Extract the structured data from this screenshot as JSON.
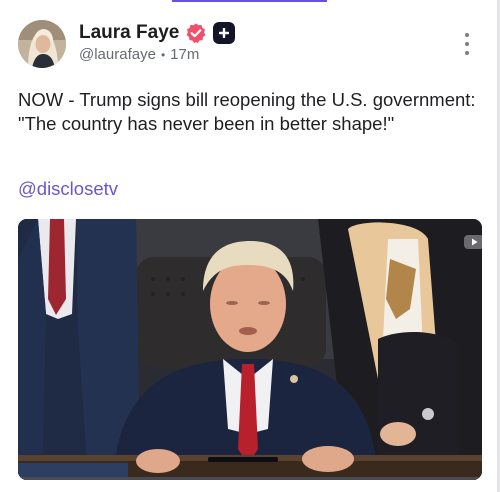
{
  "author": {
    "display_name": "Laura Faye",
    "handle": "@laurafaye",
    "time_ago": "17m",
    "verified": true
  },
  "post": {
    "text": "NOW - Trump signs bill reopening the U.S. government: \"The country has never been in better shape!\"",
    "mention": "@disclosetv"
  },
  "media": {
    "type": "video",
    "progress": 0
  },
  "colors": {
    "accent": "#6b4fe0",
    "mention": "#6a57c9",
    "verified_badge": "#f1506b",
    "plus_badge": "#15152a"
  },
  "icons": {
    "verified": "verified-check-icon",
    "plus": "plus-badge-icon",
    "more": "more-vertical-icon",
    "video": "video-play-icon"
  }
}
